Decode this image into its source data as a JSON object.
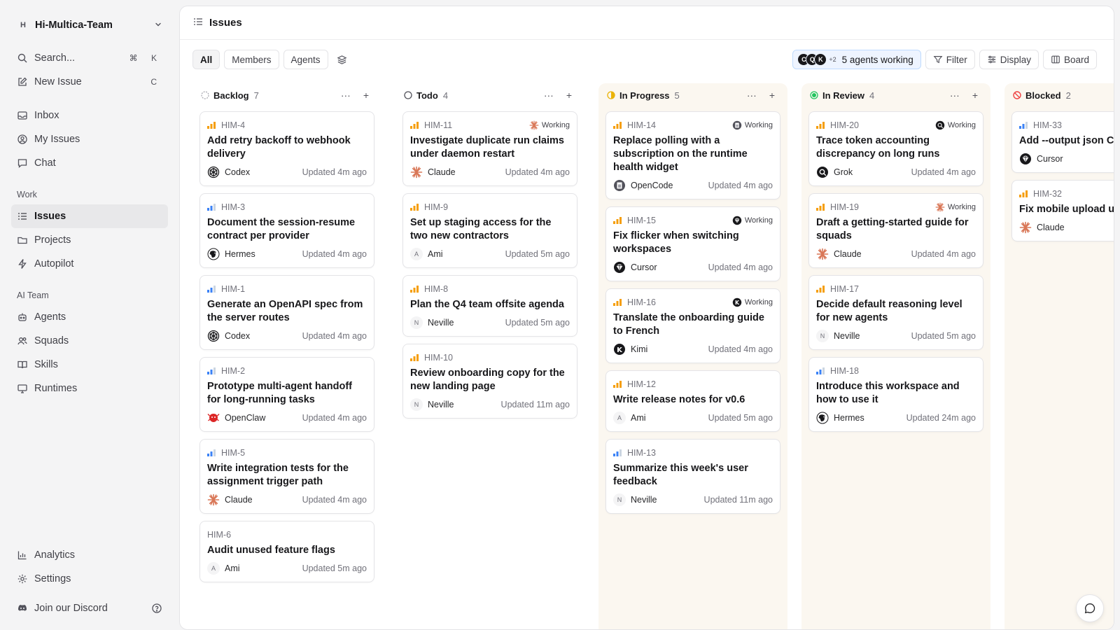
{
  "sidebar": {
    "workspace": {
      "initial": "H",
      "name": "Hi-Multica-Team"
    },
    "top_items": [
      {
        "label": "Search...",
        "icon": "search-icon",
        "shortcut": "⌘ K"
      },
      {
        "label": "New Issue",
        "icon": "edit-icon",
        "shortcut": "C"
      }
    ],
    "main_items": [
      {
        "label": "Inbox",
        "icon": "inbox-icon"
      },
      {
        "label": "My Issues",
        "icon": "user-circle-icon"
      },
      {
        "label": "Chat",
        "icon": "chat-icon"
      }
    ],
    "work_label": "Work",
    "work_items": [
      {
        "label": "Issues",
        "icon": "list-icon",
        "active": true
      },
      {
        "label": "Projects",
        "icon": "folder-icon"
      },
      {
        "label": "Autopilot",
        "icon": "bolt-icon"
      }
    ],
    "ai_label": "AI Team",
    "ai_items": [
      {
        "label": "Agents",
        "icon": "bot-icon"
      },
      {
        "label": "Squads",
        "icon": "users-icon"
      },
      {
        "label": "Skills",
        "icon": "book-icon"
      },
      {
        "label": "Runtimes",
        "icon": "monitor-icon"
      }
    ],
    "bottom_items": [
      {
        "label": "Analytics",
        "icon": "chart-icon"
      },
      {
        "label": "Settings",
        "icon": "gear-icon"
      },
      {
        "label": "Join our Discord",
        "icon": "discord-icon"
      }
    ]
  },
  "header": {
    "title": "Issues"
  },
  "toolbar": {
    "filters": [
      "All",
      "Members",
      "Agents"
    ],
    "active_filter": "All",
    "agents_working": {
      "avatars": [
        "C",
        "Q",
        "K"
      ],
      "more": "+2",
      "label": "5 agents working"
    },
    "filter_label": "Filter",
    "display_label": "Display",
    "board_label": "Board"
  },
  "colors": {
    "accent_blue": "#3b82f6",
    "priority_orange": "#f59e0b",
    "in_progress": "#eab308",
    "in_review": "#22c55e",
    "blocked": "#ef4444",
    "claude": "#d97757",
    "openclaw": "#dc2626"
  },
  "columns": [
    {
      "title": "Backlog",
      "count": "7",
      "status": "backlog",
      "tinted": false,
      "cards": [
        {
          "id": "HIM-4",
          "prio": "high",
          "title": "Add retry backoff to webhook delivery",
          "assignee": "Codex",
          "avatar": "codex",
          "updated": "Updated 4m ago"
        },
        {
          "id": "HIM-3",
          "prio": "low",
          "title": "Document the session-resume contract per provider",
          "assignee": "Hermes",
          "avatar": "hermes",
          "updated": "Updated 4m ago"
        },
        {
          "id": "HIM-1",
          "prio": "low",
          "title": "Generate an OpenAPI spec from the server routes",
          "assignee": "Codex",
          "avatar": "codex",
          "updated": "Updated 4m ago"
        },
        {
          "id": "HIM-2",
          "prio": "low",
          "title": "Prototype multi-agent handoff for long-running tasks",
          "assignee": "OpenClaw",
          "avatar": "openclaw",
          "updated": "Updated 4m ago"
        },
        {
          "id": "HIM-5",
          "prio": "low",
          "title": "Write integration tests for the assignment trigger path",
          "assignee": "Claude",
          "avatar": "claude",
          "updated": "Updated 4m ago"
        },
        {
          "id": "HIM-6",
          "prio": "none",
          "title": "Audit unused feature flags",
          "assignee": "Ami",
          "avatar": "letter",
          "initial": "A",
          "updated": "Updated 5m ago"
        }
      ]
    },
    {
      "title": "Todo",
      "count": "4",
      "status": "todo",
      "tinted": false,
      "cards": [
        {
          "id": "HIM-11",
          "prio": "high",
          "title": "Investigate duplicate run claims under daemon restart",
          "assignee": "Claude",
          "avatar": "claude",
          "updated": "Updated 4m ago",
          "working": "Working",
          "working_icon": "claude"
        },
        {
          "id": "HIM-9",
          "prio": "high",
          "title": "Set up staging access for the two new contractors",
          "assignee": "Ami",
          "avatar": "letter",
          "initial": "A",
          "updated": "Updated 5m ago"
        },
        {
          "id": "HIM-8",
          "prio": "high",
          "title": "Plan the Q4 team offsite agenda",
          "assignee": "Neville",
          "avatar": "letter",
          "initial": "N",
          "updated": "Updated 5m ago"
        },
        {
          "id": "HIM-10",
          "prio": "high",
          "title": "Review onboarding copy for the new landing page",
          "assignee": "Neville",
          "avatar": "letter",
          "initial": "N",
          "updated": "Updated 11m ago"
        }
      ]
    },
    {
      "title": "In Progress",
      "count": "5",
      "status": "inprogress",
      "tinted": true,
      "cards": [
        {
          "id": "HIM-14",
          "prio": "high",
          "title": "Replace polling with a subscription on the runtime health widget",
          "assignee": "OpenCode",
          "avatar": "opencode",
          "updated": "Updated 4m ago",
          "working": "Working",
          "working_icon": "opencode"
        },
        {
          "id": "HIM-15",
          "prio": "high",
          "title": "Fix flicker when switching workspaces",
          "assignee": "Cursor",
          "avatar": "cursor",
          "updated": "Updated 4m ago",
          "working": "Working",
          "working_icon": "cursor"
        },
        {
          "id": "HIM-16",
          "prio": "high",
          "title": "Translate the onboarding guide to French",
          "assignee": "Kimi",
          "avatar": "kimi",
          "updated": "Updated 4m ago",
          "working": "Working",
          "working_icon": "kimi"
        },
        {
          "id": "HIM-12",
          "prio": "high",
          "title": "Write release notes for v0.6",
          "assignee": "Ami",
          "avatar": "letter",
          "initial": "A",
          "updated": "Updated 5m ago"
        },
        {
          "id": "HIM-13",
          "prio": "low",
          "title": "Summarize this week's user feedback",
          "assignee": "Neville",
          "avatar": "letter",
          "initial": "N",
          "updated": "Updated 11m ago"
        }
      ]
    },
    {
      "title": "In Review",
      "count": "4",
      "status": "inreview",
      "tinted": true,
      "cards": [
        {
          "id": "HIM-20",
          "prio": "high",
          "title": "Trace token accounting discrepancy on long runs",
          "assignee": "Grok",
          "avatar": "grok",
          "updated": "Updated 4m ago",
          "working": "Working",
          "working_icon": "grok"
        },
        {
          "id": "HIM-19",
          "prio": "high",
          "title": "Draft a getting-started guide for squads",
          "assignee": "Claude",
          "avatar": "claude",
          "updated": "Updated 4m ago",
          "working": "Working",
          "working_icon": "claude"
        },
        {
          "id": "HIM-17",
          "prio": "high",
          "title": "Decide default reasoning level for new agents",
          "assignee": "Neville",
          "avatar": "letter",
          "initial": "N",
          "updated": "Updated 5m ago"
        },
        {
          "id": "HIM-18",
          "prio": "low",
          "title": "Introduce this workspace and how to use it",
          "assignee": "Hermes",
          "avatar": "hermes",
          "updated": "Updated 24m ago"
        }
      ]
    },
    {
      "title": "Blocked",
      "count": "2",
      "status": "blocked",
      "tinted": true,
      "cards": [
        {
          "id": "HIM-33",
          "prio": "low",
          "title": "Add --output json CLI docs",
          "assignee": "Cursor",
          "avatar": "cursor",
          "updated": ""
        },
        {
          "id": "HIM-32",
          "prio": "high",
          "title": "Fix mobile upload updating",
          "assignee": "Claude",
          "avatar": "claude",
          "updated": ""
        }
      ]
    }
  ]
}
